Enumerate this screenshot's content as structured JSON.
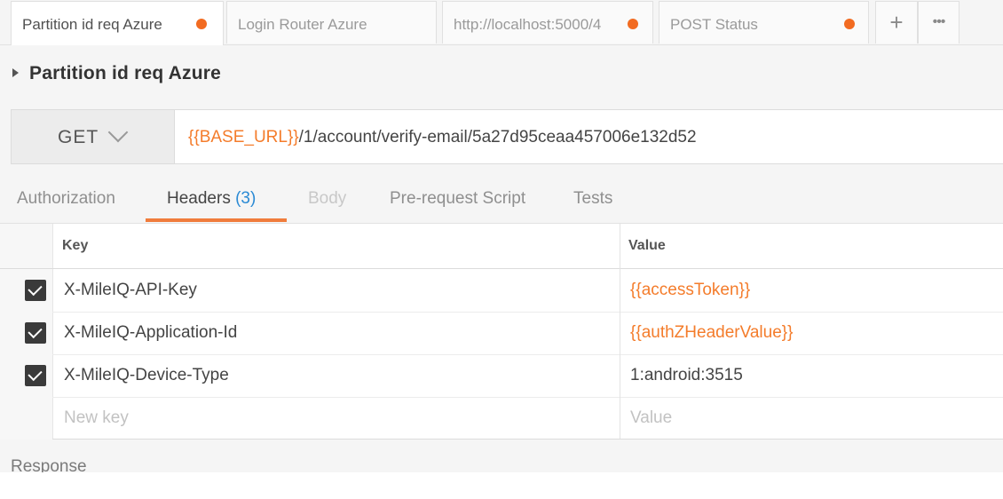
{
  "tabs": [
    {
      "label": "Partition id req Azure",
      "active": true,
      "unsaved": true
    },
    {
      "label": "Login Router Azure",
      "active": false,
      "unsaved": false
    },
    {
      "label": "http://localhost:5000/4",
      "active": false,
      "unsaved": true
    },
    {
      "label": "POST Status",
      "active": false,
      "unsaved": true
    }
  ],
  "tab_actions": {
    "add": "+",
    "more": "•••"
  },
  "request": {
    "name": "Partition id req Azure",
    "method": "GET",
    "url_var": "{{BASE_URL}}",
    "url_path": "/1/account/verify-email/5a27d95ceaa457006e132d52"
  },
  "section_tabs": {
    "authorization": "Authorization",
    "headers": "Headers",
    "headers_count": "(3)",
    "body": "Body",
    "prerequest": "Pre-request Script",
    "tests": "Tests"
  },
  "headers_table": {
    "key_header": "Key",
    "value_header": "Value",
    "rows": [
      {
        "key": "X-MileIQ-API-Key",
        "value": "{{accessToken}}",
        "checked": true
      },
      {
        "key": "X-MileIQ-Application-Id",
        "value": "{{authZHeaderValue}}",
        "checked": true
      },
      {
        "key": "X-MileIQ-Device-Type",
        "value": "1:android:3515",
        "checked": true
      }
    ],
    "new_key_placeholder": "New key",
    "new_value_placeholder": "Value"
  },
  "response": {
    "label": "Response"
  },
  "colors": {
    "accent": "#f26b21",
    "variable": "#f47c2b",
    "count": "#2a8ad4"
  }
}
